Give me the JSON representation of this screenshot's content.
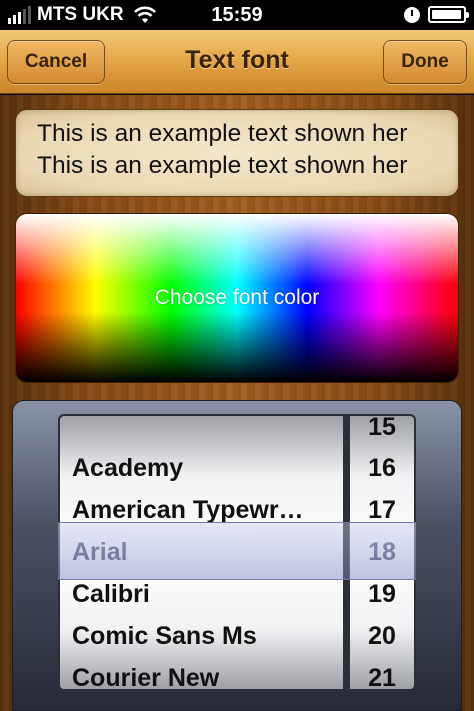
{
  "status_bar": {
    "carrier": "MTS UKR",
    "time": "15:59",
    "signal_bars": 3,
    "battery_level": 0.95
  },
  "nav": {
    "cancel_label": "Cancel",
    "title": "Text font",
    "done_label": "Done"
  },
  "example": {
    "lines": [
      "This is an example text shown her",
      "This is an example text shown her"
    ]
  },
  "color_picker": {
    "label": "Choose font color"
  },
  "font_picker": {
    "fonts": [
      "Academy",
      "American Typewr…",
      "Arial",
      "Calibri",
      "Comic Sans Ms",
      "Courier New"
    ],
    "selected_font": "Arial",
    "sizes": [
      "15",
      "16",
      "17",
      "18",
      "19",
      "20",
      "21"
    ],
    "selected_size": "18"
  },
  "colors": {
    "nav_gradient_top": "#f3c979",
    "nav_gradient_bottom": "#c9852a",
    "wood": "#8a4c16",
    "selection_tint": "#a9b0e0"
  }
}
